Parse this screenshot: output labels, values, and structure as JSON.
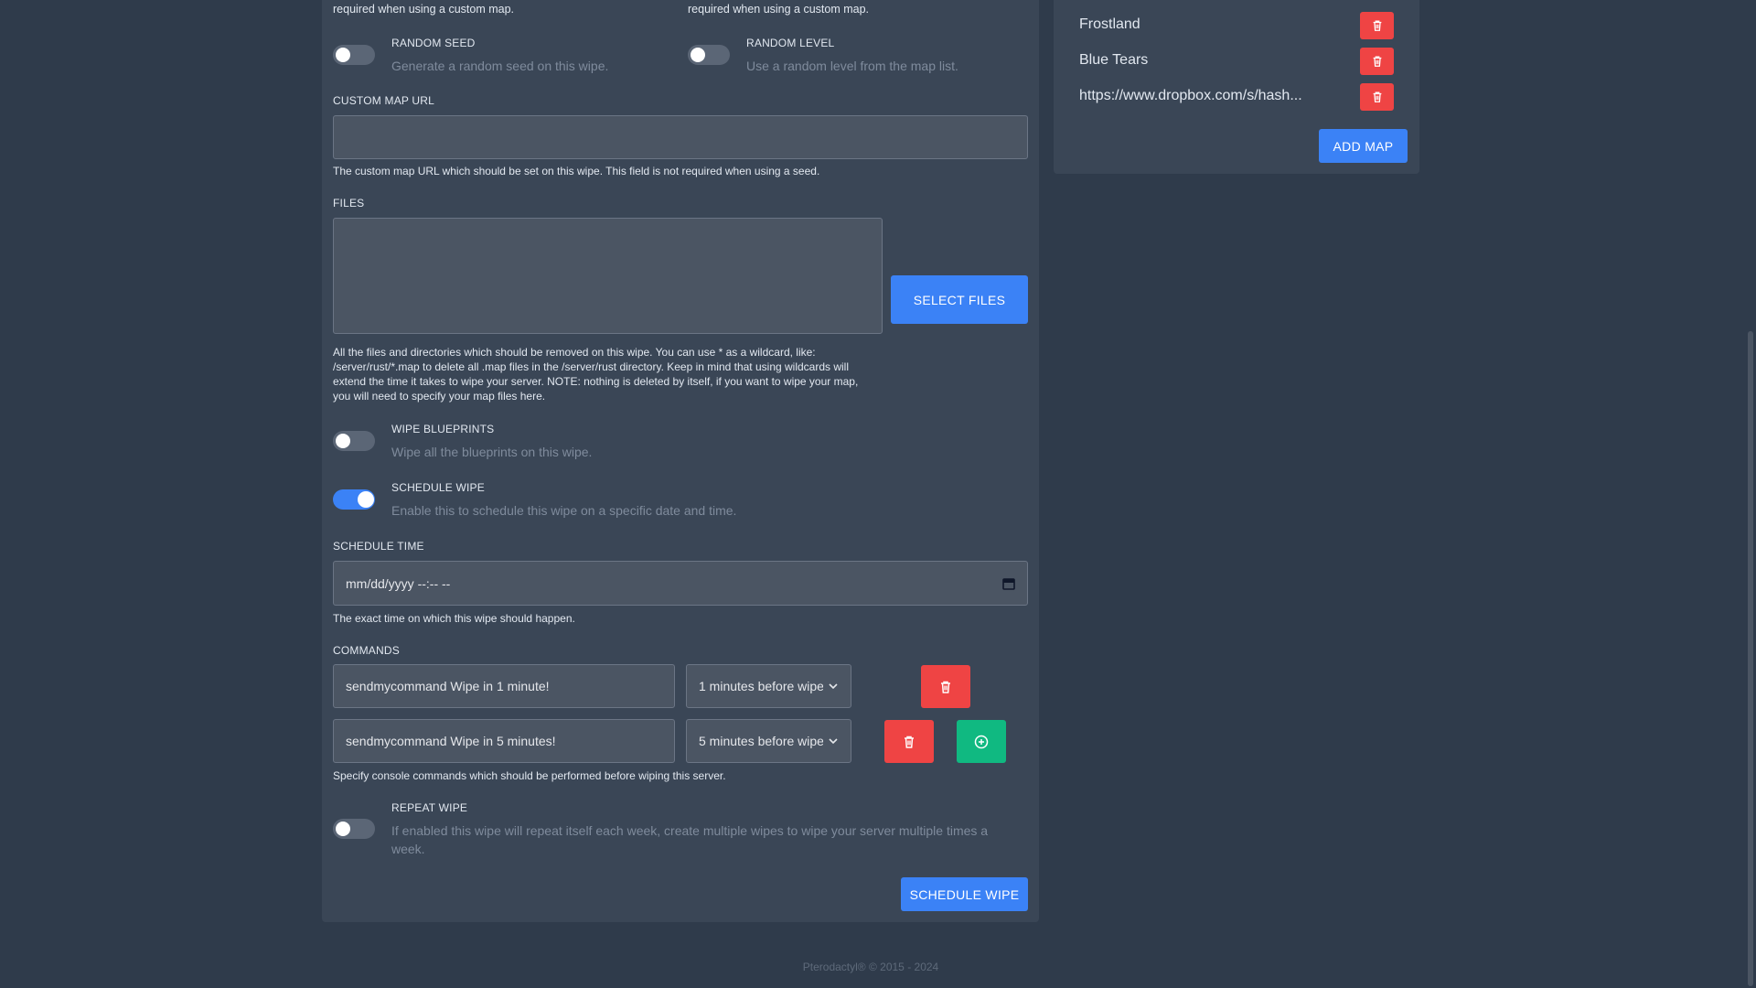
{
  "top": {
    "left_text": "required when using a custom map.",
    "right_text": "required when using a custom map."
  },
  "random_seed": {
    "label": "RANDOM SEED",
    "desc": "Generate a random seed on this wipe.",
    "on": false
  },
  "random_level": {
    "label": "RANDOM LEVEL",
    "desc": "Use a random level from the map list.",
    "on": false
  },
  "custom_map_url": {
    "label": "CUSTOM MAP URL",
    "value": "",
    "help": "The custom map URL which should be set on this wipe. This field is not required when using a seed."
  },
  "files": {
    "label": "FILES",
    "value": "",
    "select_button": "SELECT FILES",
    "help_lines": [
      "All the files and directories which should be removed on this wipe. You can use * as a wildcard, like:",
      "/server/rust/*.map to delete all .map files in the /server/rust directory. Keep in mind that using wildcards will",
      "extend the time it takes to wipe your server. NOTE: nothing is deleted by itself, if you want to wipe your map,",
      "you will need to specify your map files here."
    ]
  },
  "wipe_blueprints": {
    "label": "WIPE BLUEPRINTS",
    "desc": "Wipe all the blueprints on this wipe.",
    "on": false
  },
  "schedule_wipe_toggle": {
    "label": "SCHEDULE WIPE",
    "desc": "Enable this to schedule this wipe on a specific date and time.",
    "on": true
  },
  "schedule_time": {
    "label": "SCHEDULE TIME",
    "placeholder": "mm/dd/yyyy --:-- --",
    "help": "The exact time on which this wipe should happen."
  },
  "commands": {
    "label": "COMMANDS",
    "rows": [
      {
        "command": "sendmycommand Wipe in 1 minute!",
        "timing": "1 minutes before wipe"
      },
      {
        "command": "sendmycommand Wipe in 5 minutes!",
        "timing": "5 minutes before wipe"
      }
    ],
    "help": "Specify console commands which should be performed before wiping this server."
  },
  "repeat_wipe": {
    "label": "REPEAT WIPE",
    "desc_line1": "If enabled this wipe will repeat itself each week, create multiple wipes to wipe your server multiple times a",
    "desc_line2": "week.",
    "on": false
  },
  "submit": {
    "label": "SCHEDULE WIPE"
  },
  "maps": {
    "items": [
      {
        "name": "Frostland"
      },
      {
        "name": "Blue Tears"
      },
      {
        "name": "https://www.dropbox.com/s/hash..."
      }
    ],
    "add_button": "ADD MAP"
  },
  "footer": {
    "text": "Pterodactyl® © 2015 - 2024"
  },
  "colors": {
    "background": "#2f3b4b",
    "panel": "#3a4656",
    "accent_blue": "#3b82f6",
    "danger_red": "#ef4444",
    "success_green": "#10b981"
  },
  "icons": {
    "delete": "trash-icon",
    "add": "plus-circle-icon",
    "calendar": "calendar-icon",
    "dropdown": "chevron-down-icon"
  }
}
